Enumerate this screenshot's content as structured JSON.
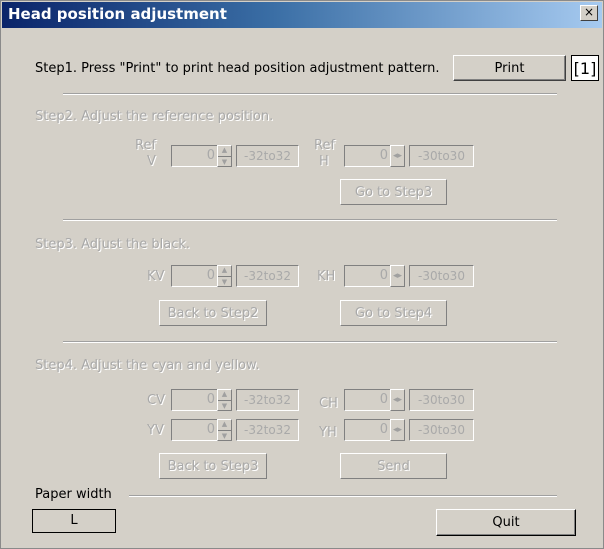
{
  "window": {
    "title": "Head position adjustment",
    "close_label": "×"
  },
  "step1": {
    "text": "Step1. Press \"Print\" to print head position adjustment pattern.",
    "print_label": "Print",
    "marker": "[1]"
  },
  "step2": {
    "text": "Step2. Adjust the reference position.",
    "ref_v_label_top": "Ref",
    "ref_v_label_bottom": "V",
    "ref_v_value": "0",
    "ref_v_range": "-32to32",
    "ref_h_label_top": "Ref",
    "ref_h_label_bottom": "H",
    "ref_h_value": "0",
    "ref_h_range": "-30to30",
    "goto_label": "Go to Step3"
  },
  "step3": {
    "text": "Step3. Adjust the black.",
    "kv_label": "KV",
    "kv_value": "0",
    "kv_range": "-32to32",
    "kh_label": "KH",
    "kh_value": "0",
    "kh_range": "-30to30",
    "back_label": "Back to Step2",
    "goto_label": "Go to Step4"
  },
  "step4": {
    "text": "Step4. Adjust the cyan and yellow.",
    "cv_label": "CV",
    "cv_value": "0",
    "cv_range": "-32to32",
    "ch_label": "CH",
    "ch_value": "0",
    "ch_range": "-30to30",
    "yv_label": "YV",
    "yv_value": "0",
    "yv_range": "-32to32",
    "yh_label": "YH",
    "yh_value": "0",
    "yh_range": "-30to30",
    "back_label": "Back to Step3",
    "send_label": "Send"
  },
  "paper": {
    "label": "Paper width",
    "value": "L"
  },
  "quit_label": "Quit"
}
